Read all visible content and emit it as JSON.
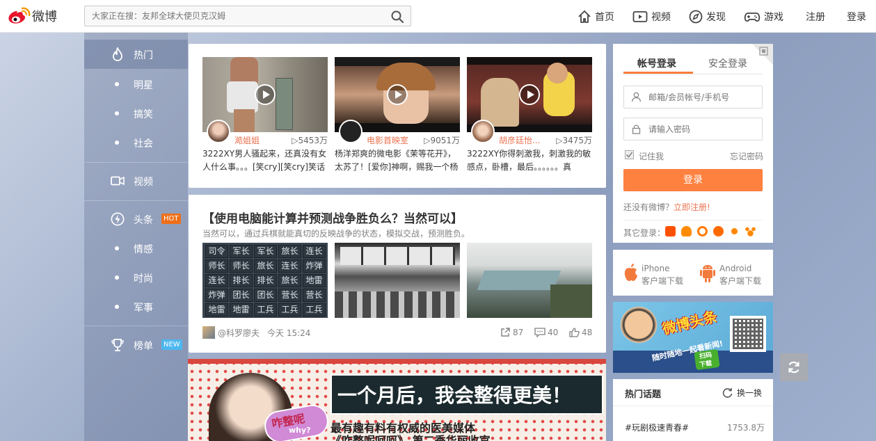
{
  "header": {
    "logo_text": "微博",
    "search_placeholder": "大家正在搜：友邦全球大使贝克汉姆",
    "nav": [
      {
        "label": "首页",
        "icon": "home-icon"
      },
      {
        "label": "视频",
        "icon": "video-icon"
      },
      {
        "label": "发现",
        "icon": "compass-icon"
      },
      {
        "label": "游戏",
        "icon": "gamepad-icon"
      }
    ],
    "register": "注册",
    "login": "登录"
  },
  "sidebar": {
    "items": [
      {
        "label": "热门",
        "icon": "flame-icon"
      },
      {
        "label": "明星"
      },
      {
        "label": "搞笑"
      },
      {
        "label": "社会"
      },
      {
        "label": "视频",
        "icon": "camera-icon"
      },
      {
        "label": "头条",
        "icon": "bolt-icon",
        "tag": "HOT"
      },
      {
        "label": "情感"
      },
      {
        "label": "时尚"
      },
      {
        "label": "军事"
      },
      {
        "label": "榜单",
        "icon": "trophy-icon",
        "tag": "NEW"
      }
    ]
  },
  "videos": [
    {
      "author": "澔姐姐",
      "count": "5453万",
      "desc": "3222XY男人骚起来，还真没有女人什么事。。。[笑cry][笑cry]笑话"
    },
    {
      "author": "电影首映室",
      "count": "9051万",
      "desc": "杨洋郑爽的微电影《茉等花开》，太苏了！[爱你]神啊，赐我一个杨"
    },
    {
      "author": "胡彦廷怡...",
      "count": "3475万",
      "desc": "3222XY你得刺激我，刺激我的敏感点，卧槽，最后。。。。。。真"
    }
  ],
  "article": {
    "title": "【使用电脑能计算并预测战争胜负么？当然可以】",
    "subtitle": "当然可以，通过兵棋就能真切的反映战争的状态，模拟交战，预测胜负。",
    "author": "@科罗廖夫",
    "time": "今天 15:24",
    "reposts": "87",
    "comments": "40",
    "likes": "48",
    "chess_pieces": [
      "司令",
      "军长",
      "军长",
      "旅长",
      "连长",
      "师长",
      "师长",
      "旅长",
      "连长",
      "炸弹",
      "连长",
      "排长",
      "排长",
      "旅长",
      "地雷",
      "炸弹",
      "团长",
      "团长",
      "营长",
      "营长",
      "地雷",
      "地雷",
      "工兵",
      "工兵",
      "工兵"
    ]
  },
  "banner": {
    "headline": "一个月后，我会整得更美！",
    "line2": "最有趣有料有权威的医美媒体",
    "line3": "《咋整呢呵呵》 第二季华丽收官",
    "badge": "咋整呢",
    "badge2": "why?"
  },
  "login_box": {
    "tab_account": "帐号登录",
    "tab_secure": "安全登录",
    "username_placeholder": "邮箱/会员帐号/手机号",
    "password_placeholder": "请输入密码",
    "remember": "记住我",
    "forgot": "忘记密码",
    "login_button": "登录",
    "no_account": "还没有微博？",
    "register_now": "立即注册!",
    "other_login": "其它登录："
  },
  "clients": [
    {
      "name": "iPhone",
      "sub": "客户端下载"
    },
    {
      "name": "Android",
      "sub": "客户端下载"
    }
  ],
  "ad": {
    "title": "微博头条",
    "slogan": "随时随地一起看新闻!",
    "scan": "扫码",
    "download": "下载"
  },
  "topics": {
    "title": "热门话题",
    "refresh": "换一换",
    "items": [
      {
        "name": "#玩剧极速青春#",
        "count": "1753.8万"
      }
    ]
  },
  "colors": {
    "brand_orange": "#ff8140",
    "link_orange": "#eb7350",
    "hot_tag": "#ee6f1a",
    "new_tag": "#4cb7f0"
  }
}
